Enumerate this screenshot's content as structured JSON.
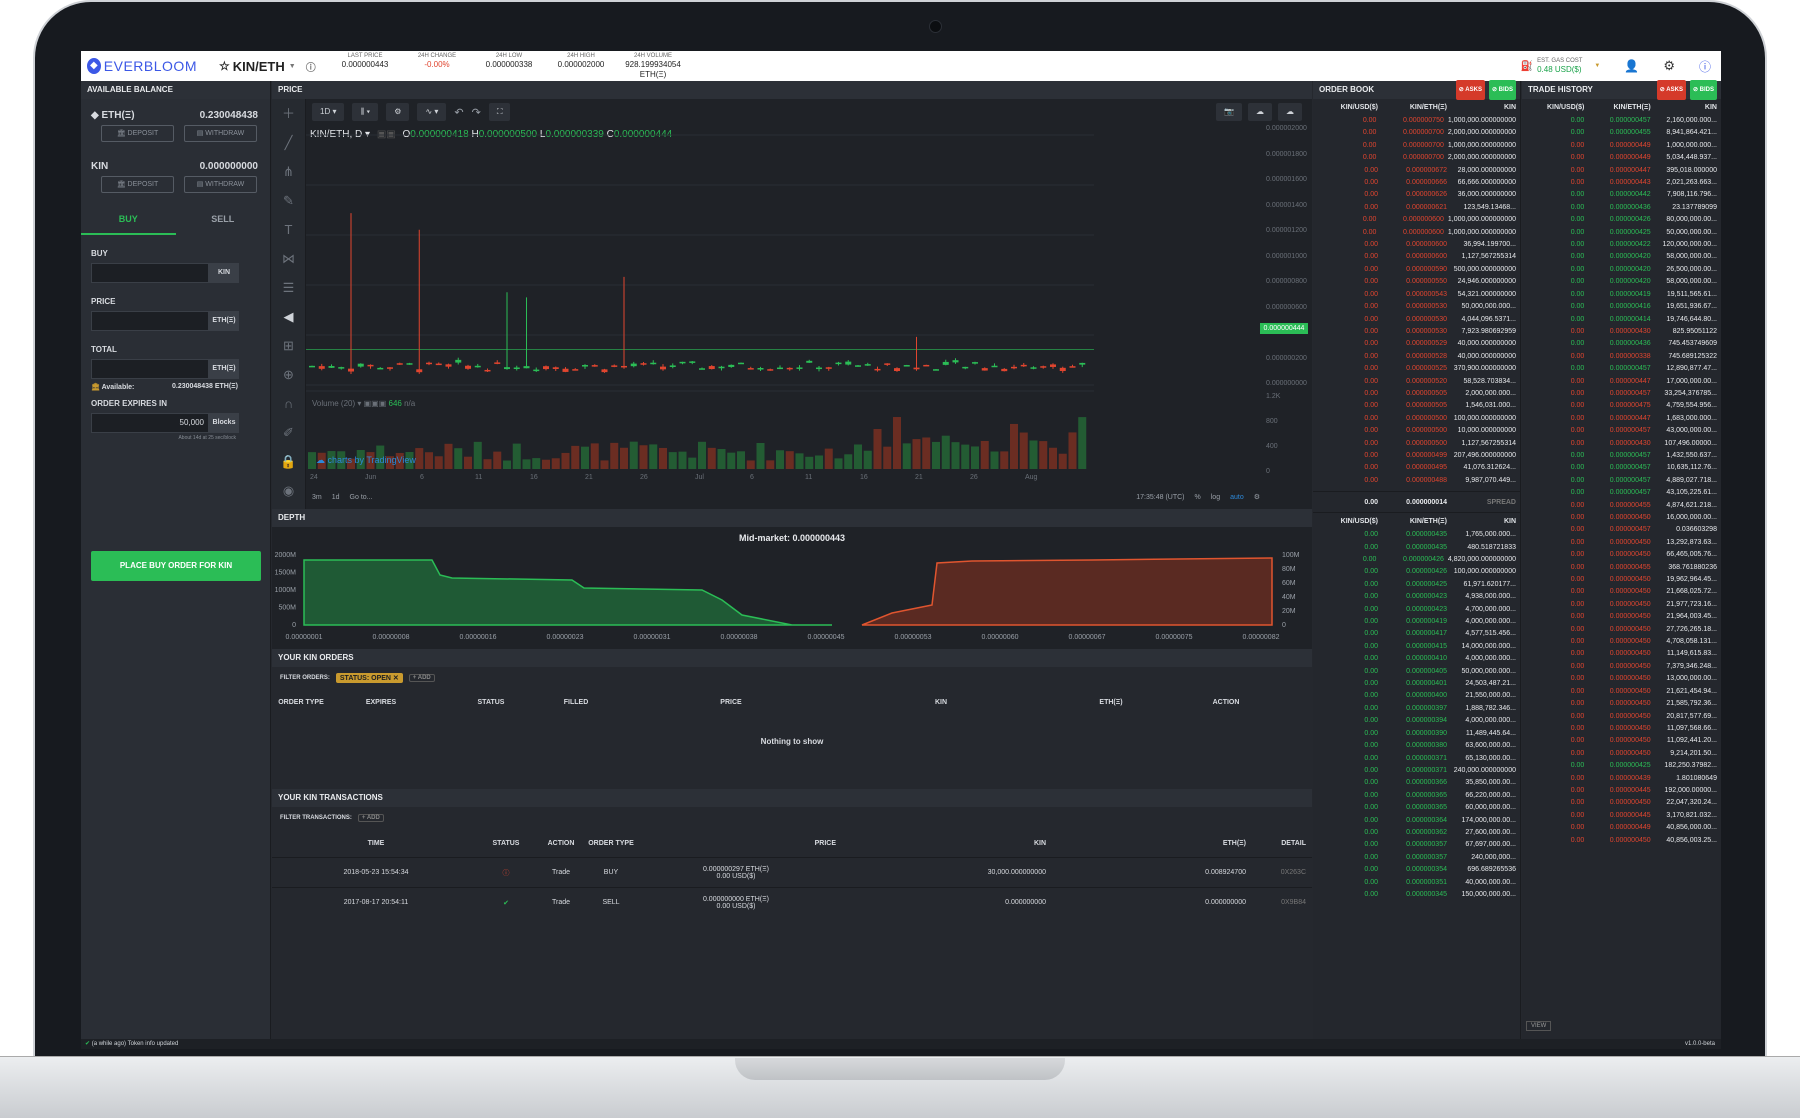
{
  "topbar": {
    "brand": "EVERBLOOM",
    "pair": "KIN/ETH",
    "stats": [
      {
        "label": "LAST PRICE",
        "value": "0.000000443",
        "color": "#222222"
      },
      {
        "label": "24H CHANGE",
        "value": "-0.00%",
        "color": "#e0452f"
      },
      {
        "label": "24H LOW",
        "value": "0.000000338",
        "color": "#222222"
      },
      {
        "label": "24H HIGH",
        "value": "0.000002000",
        "color": "#222222"
      },
      {
        "label": "24H VOLUME",
        "value": "928.199934054 ETH(Ξ)",
        "color": "#222222"
      }
    ],
    "gas_label": "EST. GAS COST",
    "gas_value": "0.48 USD($)"
  },
  "left": {
    "header": "AVAILABLE BALANCE",
    "eth_label": "ETH(Ξ)",
    "eth_value": "0.230048438",
    "kin_label": "KIN",
    "kin_value": "0.000000000",
    "deposit": "DEPOSIT",
    "withdraw": "WITHDRAW",
    "buy_tab": "BUY",
    "sell_tab": "SELL",
    "buy_label": "BUY",
    "price_label": "PRICE",
    "total_label": "TOTAL",
    "kin_unit": "KIN",
    "eth_unit": "ETH(Ξ)",
    "available_label": "Available:",
    "available_value": "0.230048438 ETH(Ξ)",
    "expires_label": "ORDER EXPIRES IN",
    "expires_value": "50,000",
    "expires_unit": "Blocks",
    "expires_note": "About 14d at 25 sec/block",
    "place_button": "PLACE BUY ORDER FOR KIN"
  },
  "price": {
    "header": "PRICE",
    "interval": "1D",
    "legend_symbol": "KIN/ETH, D",
    "o": "0.000000418",
    "h": "0.000000500",
    "l": "0.000000339",
    "c": "0.000000444",
    "y_ticks": [
      "0.000002000",
      "0.000001800",
      "0.000001600",
      "0.000001400",
      "0.000001200",
      "0.000001000",
      "0.000000800",
      "0.000000600",
      "0.000000400",
      "0.000000200",
      "0.000000000"
    ],
    "last_price_tag": "0.000000444",
    "volume_label": "Volume (20)",
    "volume_value": "646",
    "volume_na": "n/a",
    "vol_ticks": [
      "1.2K",
      "800",
      "400",
      "0"
    ],
    "x_ticks": [
      "24",
      "Jun",
      "6",
      "11",
      "16",
      "21",
      "26",
      "Jul",
      "6",
      "11",
      "16",
      "21",
      "26",
      "Aug"
    ],
    "watermark": "charts by TradingView",
    "range_3m": "3m",
    "range_1d": "1d",
    "goto": "Go to...",
    "time": "17:35:48 (UTC)",
    "pct": "%",
    "log": "log",
    "auto": "auto"
  },
  "depth": {
    "header": "DEPTH",
    "mid_market": "Mid-market: 0.000000443",
    "left_ticks": [
      "2000M",
      "1500M",
      "1000M",
      "500M",
      "0"
    ],
    "right_ticks": [
      "100M",
      "80M",
      "60M",
      "40M",
      "20M",
      "0"
    ],
    "x_ticks": [
      "0.00000001",
      "0.00000008",
      "0.00000016",
      "0.00000023",
      "0.00000031",
      "0.00000038",
      "0.00000045",
      "0.00000053",
      "0.00000060",
      "0.00000067",
      "0.00000075",
      "0.00000082"
    ]
  },
  "orders": {
    "header": "YOUR KIN ORDERS",
    "filter_label": "FILTER ORDERS:",
    "chip": "STATUS: OPEN ✕",
    "add": "+ ADD",
    "columns": [
      "ORDER TYPE",
      "EXPIRES",
      "STATUS",
      "FILLED",
      "PRICE",
      "KIN",
      "ETH(Ξ)",
      "ACTION"
    ],
    "empty": "Nothing to show"
  },
  "transactions": {
    "header": "YOUR KIN TRANSACTIONS",
    "filter_label": "FILTER TRANSACTIONS:",
    "add": "+ ADD",
    "columns": [
      "TIME",
      "STATUS",
      "ACTION",
      "ORDER TYPE",
      "PRICE",
      "KIN",
      "ETH(Ξ)",
      "DETAIL"
    ],
    "rows": [
      {
        "time": "2018-05-23 15:54:34",
        "action": "Trade",
        "type": "BUY",
        "price1": "0.000000297 ETH(Ξ)",
        "price2": "0.00 USD($)",
        "kin": "30,000.000000000",
        "eth": "0.008924700",
        "detail": "0X263C"
      },
      {
        "time": "2017-08-17 20:54:11",
        "action": "Trade",
        "type": "SELL",
        "price1": "0.000000000 ETH(Ξ)",
        "price2": "0.00 USD($)",
        "kin": "0.000000000",
        "eth": "0.000000000",
        "detail": "0X9B84"
      }
    ]
  },
  "orderbook": {
    "header": "ORDER BOOK",
    "asks": "ASKS",
    "bids": "BIDS",
    "cols": [
      "KIN/USD($)",
      "KIN/ETH(Ξ)",
      "KIN"
    ],
    "asks_rows": [
      [
        "0.00",
        "0.000000750",
        "1,000,000.000000000"
      ],
      [
        "0.00",
        "0.000000700",
        "2,000,000.000000000"
      ],
      [
        "0.00",
        "0.000000700",
        "1,000,000.000000000"
      ],
      [
        "0.00",
        "0.000000700",
        "2,000,000.000000000"
      ],
      [
        "0.00",
        "0.000000672",
        "28,000.000000000"
      ],
      [
        "0.00",
        "0.000000666",
        "66,666.000000000"
      ],
      [
        "0.00",
        "0.000000626",
        "36,000.000000000"
      ],
      [
        "0.00",
        "0.000000621",
        "123,549.13468..."
      ],
      [
        "0.00",
        "0.000000600",
        "1,000,000.000000000"
      ],
      [
        "0.00",
        "0.000000600",
        "1,000,000.000000000"
      ],
      [
        "0.00",
        "0.000000600",
        "36,994.199700..."
      ],
      [
        "0.00",
        "0.000000600",
        "1,127,567255314"
      ],
      [
        "0.00",
        "0.000000590",
        "500,000.000000000"
      ],
      [
        "0.00",
        "0.000000550",
        "24,946.000000000"
      ],
      [
        "0.00",
        "0.000000543",
        "54,321.000000000"
      ],
      [
        "0.00",
        "0.000000530",
        "50,000,000.000..."
      ],
      [
        "0.00",
        "0.000000530",
        "4,044,096.5371..."
      ],
      [
        "0.00",
        "0.000000530",
        "7,923.980692959"
      ],
      [
        "0.00",
        "0.000000529",
        "40,000.000000000"
      ],
      [
        "0.00",
        "0.000000528",
        "40,000.000000000"
      ],
      [
        "0.00",
        "0.000000525",
        "370,900.000000000"
      ],
      [
        "0.00",
        "0.000000520",
        "58,528.703834..."
      ],
      [
        "0.00",
        "0.000000505",
        "2,000,000.000..."
      ],
      [
        "0.00",
        "0.000000505",
        "1,546,031.000..."
      ],
      [
        "0.00",
        "0.000000500",
        "100,000.000000000"
      ],
      [
        "0.00",
        "0.000000500",
        "10,000.000000000"
      ],
      [
        "0.00",
        "0.000000500",
        "1,127,567255314"
      ],
      [
        "0.00",
        "0.000000499",
        "207,496.000000000"
      ],
      [
        "0.00",
        "0.000000495",
        "41,076.312624..."
      ],
      [
        "0.00",
        "0.000000488",
        "9,987,070.449..."
      ]
    ],
    "spread_usd": "0.00",
    "spread_eth": "0.000000014",
    "spread_label": "SPREAD",
    "bids_rows": [
      [
        "0.00",
        "0.000000435",
        "1,765,000.000..."
      ],
      [
        "0.00",
        "0.000000435",
        "480.518721833"
      ],
      [
        "0.00",
        "0.000000426",
        "4,820,000.000000000"
      ],
      [
        "0.00",
        "0.000000426",
        "100,000.000000000"
      ],
      [
        "0.00",
        "0.000000425",
        "61,971.620177..."
      ],
      [
        "0.00",
        "0.000000423",
        "4,938,000.000..."
      ],
      [
        "0.00",
        "0.000000423",
        "4,700,000.000..."
      ],
      [
        "0.00",
        "0.000000419",
        "4,000,000.000..."
      ],
      [
        "0.00",
        "0.000000417",
        "4,577,515.456..."
      ],
      [
        "0.00",
        "0.000000415",
        "14,000,000.000..."
      ],
      [
        "0.00",
        "0.000000410",
        "4,000,000.000..."
      ],
      [
        "0.00",
        "0.000000405",
        "50,000,000.000..."
      ],
      [
        "0.00",
        "0.000000401",
        "24,503,487.21..."
      ],
      [
        "0.00",
        "0.000000400",
        "21,550,000.00..."
      ],
      [
        "0.00",
        "0.000000397",
        "1,888,782.346..."
      ],
      [
        "0.00",
        "0.000000394",
        "4,000,000.000..."
      ],
      [
        "0.00",
        "0.000000390",
        "11,489,445.64..."
      ],
      [
        "0.00",
        "0.000000380",
        "63,600,000.00..."
      ],
      [
        "0.00",
        "0.000000371",
        "65,130,000.00..."
      ],
      [
        "0.00",
        "0.000000371",
        "240,000.000000000"
      ],
      [
        "0.00",
        "0.000000366",
        "35,850,000.00..."
      ],
      [
        "0.00",
        "0.000000365",
        "66,220,000.00..."
      ],
      [
        "0.00",
        "0.000000365",
        "60,000,000.00..."
      ],
      [
        "0.00",
        "0.000000364",
        "174,000,000.00..."
      ],
      [
        "0.00",
        "0.000000362",
        "27,600,000.00..."
      ],
      [
        "0.00",
        "0.000000357",
        "67,697,000.00..."
      ],
      [
        "0.00",
        "0.000000357",
        "240,000,000..."
      ],
      [
        "0.00",
        "0.000000354",
        "696.689265536"
      ],
      [
        "0.00",
        "0.000000351",
        "40,000,000.00..."
      ],
      [
        "0.00",
        "0.000000345",
        "150,000,000.00..."
      ]
    ]
  },
  "history": {
    "header": "TRADE HISTORY",
    "asks": "ASKS",
    "bids": "BIDS",
    "cols": [
      "KIN/USD($)",
      "KIN/ETH(Ξ)",
      "KIN"
    ],
    "view": "VIEW",
    "rows": [
      [
        "0.00",
        "0.000000457",
        "2,160,000.000...",
        "b"
      ],
      [
        "0.00",
        "0.000000455",
        "8,941,864.421...",
        "b"
      ],
      [
        "0.00",
        "0.000000449",
        "1,000,000.000...",
        "s"
      ],
      [
        "0.00",
        "0.000000449",
        "5,034,448.937...",
        "s"
      ],
      [
        "0.00",
        "0.000000447",
        "395,018.000000",
        "s"
      ],
      [
        "0.00",
        "0.000000443",
        "2,021,263.663...",
        "s"
      ],
      [
        "0.00",
        "0.000000442",
        "7,908,116.796...",
        "b"
      ],
      [
        "0.00",
        "0.000000436",
        "23.137789099",
        "b"
      ],
      [
        "0.00",
        "0.000000426",
        "80,000,000.00...",
        "b"
      ],
      [
        "0.00",
        "0.000000425",
        "50,000,000.00...",
        "b"
      ],
      [
        "0.00",
        "0.000000422",
        "120,000,000.00...",
        "b"
      ],
      [
        "0.00",
        "0.000000420",
        "58,000,000.00...",
        "b"
      ],
      [
        "0.00",
        "0.000000420",
        "26,500,000.00...",
        "b"
      ],
      [
        "0.00",
        "0.000000420",
        "58,000,000.00...",
        "b"
      ],
      [
        "0.00",
        "0.000000419",
        "19,511,565.61...",
        "b"
      ],
      [
        "0.00",
        "0.000000416",
        "19,651,936.67...",
        "b"
      ],
      [
        "0.00",
        "0.000000414",
        "19,746,644.80...",
        "b"
      ],
      [
        "0.00",
        "0.000000430",
        "825.95051122",
        "s"
      ],
      [
        "0.00",
        "0.000000436",
        "745.453749609",
        "b"
      ],
      [
        "0.00",
        "0.000000338",
        "745.689125322",
        "s"
      ],
      [
        "0.00",
        "0.000000457",
        "12,890,877.47...",
        "b"
      ],
      [
        "0.00",
        "0.000000447",
        "17,000,000.00...",
        "s"
      ],
      [
        "0.00",
        "0.000000457",
        "33,254,376785...",
        "s"
      ],
      [
        "0.00",
        "0.000000475",
        "4,759,554.956...",
        "s"
      ],
      [
        "0.00",
        "0.000000447",
        "1,683,000.000...",
        "s"
      ],
      [
        "0.00",
        "0.000000457",
        "43,000,000.00...",
        "s"
      ],
      [
        "0.00",
        "0.000000430",
        "107,496.00000...",
        "s"
      ],
      [
        "0.00",
        "0.000000457",
        "1,432,550.637...",
        "b"
      ],
      [
        "0.00",
        "0.000000457",
        "10,635,112.76...",
        "b"
      ],
      [
        "0.00",
        "0.000000457",
        "4,889,027.718...",
        "b"
      ],
      [
        "0.00",
        "0.000000457",
        "43,105,225.61...",
        "b"
      ],
      [
        "0.00",
        "0.000000455",
        "4,874,621.218...",
        "s"
      ],
      [
        "0.00",
        "0.000000450",
        "16,000,000.00...",
        "s"
      ],
      [
        "0.00",
        "0.000000457",
        "0.036603298",
        "s"
      ],
      [
        "0.00",
        "0.000000450",
        "13,292,873.63...",
        "s"
      ],
      [
        "0.00",
        "0.000000450",
        "66,465,005.76...",
        "s"
      ],
      [
        "0.00",
        "0.000000455",
        "368.761880236",
        "s"
      ],
      [
        "0.00",
        "0.000000450",
        "19,962,964.45...",
        "s"
      ],
      [
        "0.00",
        "0.000000450",
        "21,668,025.72...",
        "s"
      ],
      [
        "0.00",
        "0.000000450",
        "21,977,723.16...",
        "s"
      ],
      [
        "0.00",
        "0.000000450",
        "21,964,003.45...",
        "s"
      ],
      [
        "0.00",
        "0.000000450",
        "27,726,265.18...",
        "s"
      ],
      [
        "0.00",
        "0.000000450",
        "4,708,058.131...",
        "s"
      ],
      [
        "0.00",
        "0.000000450",
        "11,149,615.83...",
        "s"
      ],
      [
        "0.00",
        "0.000000450",
        "7,379,346.248...",
        "s"
      ],
      [
        "0.00",
        "0.000000450",
        "13,000,000.00...",
        "s"
      ],
      [
        "0.00",
        "0.000000450",
        "21,621,454.94...",
        "s"
      ],
      [
        "0.00",
        "0.000000450",
        "21,585,792.36...",
        "s"
      ],
      [
        "0.00",
        "0.000000450",
        "20,817,577.69...",
        "s"
      ],
      [
        "0.00",
        "0.000000450",
        "11,097,568.66...",
        "s"
      ],
      [
        "0.00",
        "0.000000450",
        "11,092,441.20...",
        "s"
      ],
      [
        "0.00",
        "0.000000450",
        "9,214,201.50...",
        "s"
      ],
      [
        "0.00",
        "0.000000425",
        "182,250.37982...",
        "b"
      ],
      [
        "0.00",
        "0.000000439",
        "1.801080649",
        "s"
      ],
      [
        "0.00",
        "0.000000445",
        "192,000.00000...",
        "s"
      ],
      [
        "0.00",
        "0.000000450",
        "22,047,320.24...",
        "s"
      ],
      [
        "0.00",
        "0.000000445",
        "3,170,821.032...",
        "s"
      ],
      [
        "0.00",
        "0.000000449",
        "40,856,000.00...",
        "s"
      ],
      [
        "0.00",
        "0.000000450",
        "40,856,003.25...",
        "s"
      ]
    ]
  },
  "status": {
    "text": "(a while ago)",
    "info": "Token info updated",
    "version": "v1.0.0-beta"
  }
}
